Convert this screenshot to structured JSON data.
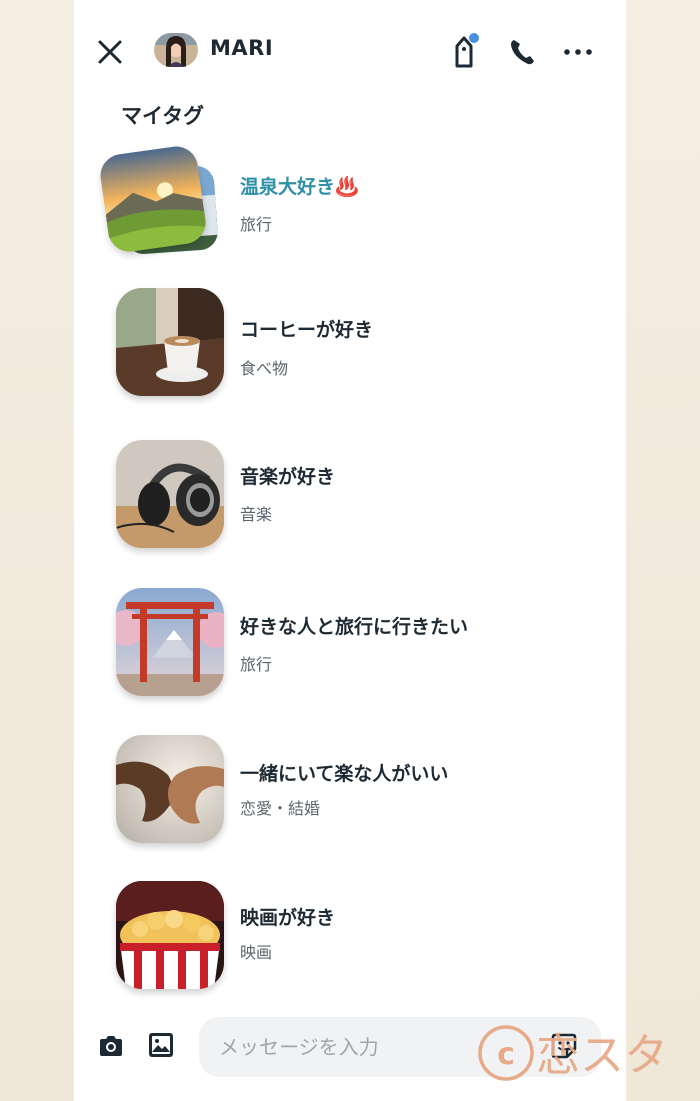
{
  "header": {
    "user_name": "MARI",
    "icons": [
      "close-icon",
      "tag-icon",
      "phone-icon",
      "more-icon"
    ],
    "notification_dot_color": "#4a90e2"
  },
  "section_title": "マイタグ",
  "tags": [
    {
      "title": "温泉大好き♨️",
      "category": "旅行",
      "highlighted": true,
      "image": "sunset-mountain"
    },
    {
      "title": "コーヒーが好き",
      "category": "食べ物",
      "highlighted": false,
      "image": "coffee-cup"
    },
    {
      "title": "音楽が好き",
      "category": "音楽",
      "highlighted": false,
      "image": "headphones"
    },
    {
      "title": "好きな人と旅行に行きたい",
      "category": "旅行",
      "highlighted": false,
      "image": "torii-fuji"
    },
    {
      "title": "一緒にいて楽な人がいい",
      "category": "恋愛・結婚",
      "highlighted": false,
      "image": "holding-hands"
    },
    {
      "title": "映画が好き",
      "category": "映画",
      "highlighted": false,
      "image": "popcorn"
    }
  ],
  "composer": {
    "placeholder": "メッセージを入力",
    "icons": [
      "camera-icon",
      "image-icon",
      "sticker-icon"
    ]
  },
  "watermark": {
    "text": "©恋スタ",
    "color": "#e8a98a"
  },
  "colors": {
    "accent": "#2f8fa6",
    "text": "#1e2a33",
    "subtext": "#5b6770"
  }
}
